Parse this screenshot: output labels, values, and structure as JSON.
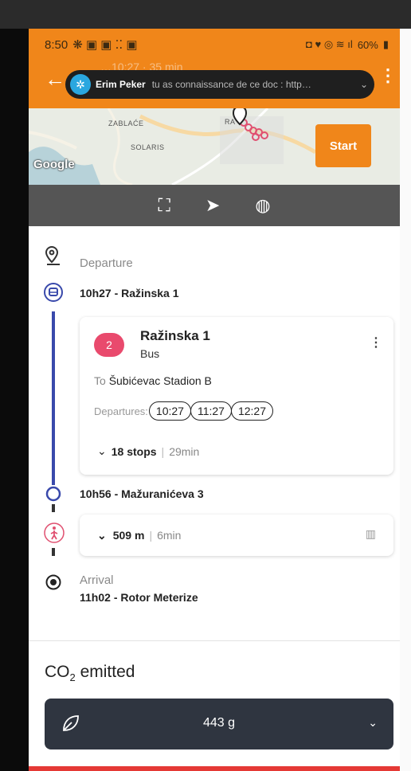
{
  "status_bar": {
    "time": "8:50",
    "left_icons": "❋ ▣ ▣ ⁚⁚ ▣",
    "right_icons": "◘ ♥ ◎ ≋ ıl",
    "battery": "60%"
  },
  "header": {
    "title_fragment": "…10:27 · 35 min",
    "back_icon": "arrow-left-icon"
  },
  "notification": {
    "sender": "Erim Peker",
    "message": "tu as connaissance de ce doc : http…"
  },
  "map": {
    "labels": [
      "ZABLAĆE",
      "SOLARIS",
      "RA"
    ],
    "attribution": "Google",
    "start_label": "Start"
  },
  "journey": {
    "departure_label": "Departure",
    "leg1_time_stop": "10h27 - Ražinska 1",
    "transit": {
      "route": "2",
      "stop_name": "Ražinska 1",
      "mode": "Bus",
      "direction_prefix": "To",
      "direction": "Šubićevac Stadion B",
      "departures_label": "Departures:",
      "departures": [
        "10:27",
        "11:27",
        "12:27"
      ],
      "stops": "18 stops",
      "duration": "29min"
    },
    "leg2_time_stop": "10h56 - Mažuranićeva 3",
    "walk": {
      "distance": "509 m",
      "duration": "6min"
    },
    "arrival_label": "Arrival",
    "arrival_time_stop": "11h02 - Rotor Meterize"
  },
  "co2": {
    "title": "emitted",
    "value": "443 g"
  },
  "colors": {
    "accent_orange": "#f0861a",
    "transit_blue": "#3949ab",
    "route_badge": "#e94a6d",
    "co2_card": "#2f3540"
  }
}
